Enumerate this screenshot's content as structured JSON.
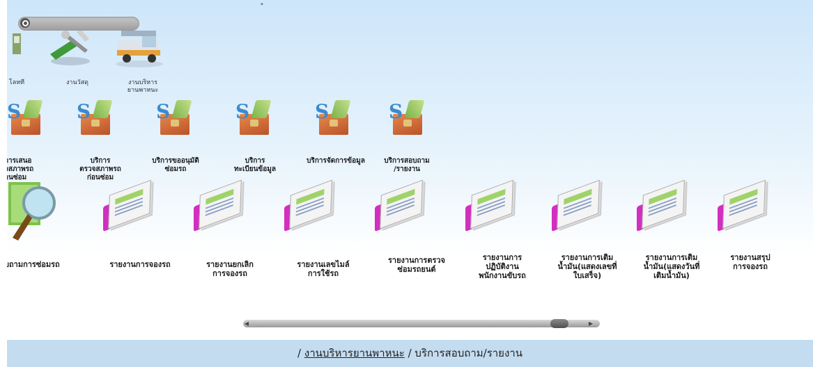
{
  "top_glyph": "ู",
  "top_apps": [
    {
      "label": "โลหที",
      "icon": "truncated-app-icon"
    },
    {
      "label": "งานวัสดุ",
      "icon": "tools-icon"
    },
    {
      "label": "งานบริหาร\nยานพาหนะ",
      "icon": "truck-icon"
    }
  ],
  "services": [
    {
      "label": "การเสนอ\nจสภาพรถ\nอนซ่อม"
    },
    {
      "label": "บริการ\nตรวจสภาพรถ\nก่อนซ่อม"
    },
    {
      "label": "บริการขออนุมัติ\nซ่อมรถ"
    },
    {
      "label": "บริการ\nทะเบียนข้อมูล"
    },
    {
      "label": "บริการจัดการข้อมูล"
    },
    {
      "label": "บริการสอบถาม\n/รายงาน"
    }
  ],
  "reports": [
    {
      "label": "บถามการซ่อมรถ"
    },
    {
      "label": "รายงานการจองรถ"
    },
    {
      "label": "รายงานยกเลิก\nการจองรถ"
    },
    {
      "label": "รายงานเลขไมล์\nการใช้รถ"
    },
    {
      "label": "รายงานการตรวจ\nซ่อมรถยนต์"
    },
    {
      "label": "รายงานการ\nปฏิบัติงาน\nพนักงานขับรถ"
    },
    {
      "label": "รายงานการเติม\nน้ำมัน(แสดงเลขที่\nใบเสร็จ)"
    },
    {
      "label": "รายงานการเติม\nน้ำมัน(แสดงวันที่\nเติมน้ำมัน)"
    },
    {
      "label": "รายงานสรุป\nการจองรถ"
    }
  ],
  "breadcrumb": {
    "sep1": "/",
    "link": "งานบริหารยานพาหนะ",
    "sep2": "/",
    "current": "บริการสอบถาม/รายงาน"
  },
  "scrollbar": {
    "position": 0.94
  }
}
